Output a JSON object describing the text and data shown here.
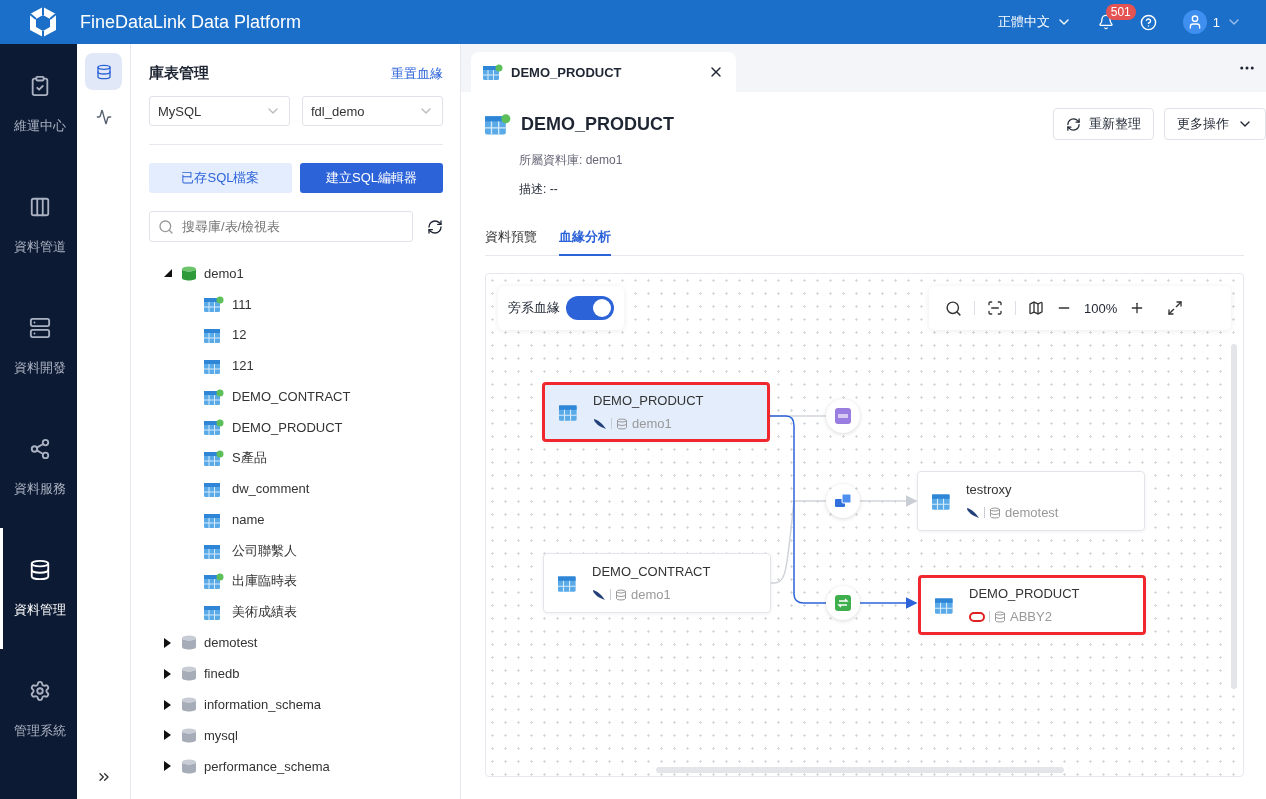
{
  "header": {
    "title": "FineDataLink Data Platform",
    "language": "正體中文",
    "notifications": "501",
    "user": "1"
  },
  "nav": [
    {
      "label": "維運中心",
      "selected": false
    },
    {
      "label": "資料管道",
      "selected": false
    },
    {
      "label": "資料開發",
      "selected": false
    },
    {
      "label": "資料服務",
      "selected": false
    },
    {
      "label": "資料管理",
      "selected": true
    },
    {
      "label": "管理系統",
      "selected": false
    }
  ],
  "subnav": [
    {
      "selected": true
    },
    {
      "selected": false
    }
  ],
  "panel": {
    "title": "庫表管理",
    "reset_link": "重置血緣",
    "db_type": "MySQL",
    "db_name": "fdl_demo",
    "saved_button": "已存SQL檔案",
    "create_button": "建立SQL編輯器",
    "search": {
      "placeholder": "搜尋庫/表/檢視表"
    },
    "tree": [
      {
        "label": "demo1",
        "expanded": true,
        "selected": true,
        "children": [
          {
            "label": "111",
            "kind": "tagged"
          },
          {
            "label": "12",
            "kind": "plain"
          },
          {
            "label": "121",
            "kind": "plain"
          },
          {
            "label": "DEMO_CONTRACT",
            "kind": "tagged"
          },
          {
            "label": "DEMO_PRODUCT",
            "kind": "tagged"
          },
          {
            "label": "S產品",
            "kind": "tagged"
          },
          {
            "label": "dw_comment",
            "kind": "plain"
          },
          {
            "label": "name",
            "kind": "plain"
          },
          {
            "label": "公司聯繫人",
            "kind": "plain"
          },
          {
            "label": "出庫臨時表",
            "kind": "tagged"
          },
          {
            "label": "美術成績表",
            "kind": "plain"
          }
        ]
      },
      {
        "label": "demotest",
        "expanded": false,
        "selected": false
      },
      {
        "label": "finedb",
        "expanded": false,
        "selected": false
      },
      {
        "label": "information_schema",
        "expanded": false,
        "selected": false
      },
      {
        "label": "mysql",
        "expanded": false,
        "selected": false
      },
      {
        "label": "performance_schema",
        "expanded": false,
        "selected": false
      }
    ]
  },
  "tab": {
    "label": "DEMO_PRODUCT"
  },
  "detail": {
    "title": "DEMO_PRODUCT",
    "database_line": "所屬資料庫: demo1",
    "description_line": "描述: --",
    "refresh_button": "重新整理",
    "more_button": "更多操作",
    "tabs": [
      {
        "label": "資料預覽",
        "selected": false
      },
      {
        "label": "血緣分析",
        "selected": true
      }
    ]
  },
  "lineage": {
    "side_lineage_label": "旁系血緣",
    "side_lineage_on": true,
    "zoom": "100%",
    "nodes": [
      {
        "name": "DEMO_PRODUCT",
        "kind": "mysql",
        "db": "demo1",
        "highlighted": true,
        "selected": true
      },
      {
        "name": "testroxy",
        "kind": "mysql",
        "db": "demotest",
        "highlighted": false,
        "selected": false
      },
      {
        "name": "DEMO_CONTRACT",
        "kind": "mysql",
        "db": "demo1",
        "highlighted": false,
        "selected": false
      },
      {
        "name": "DEMO_PRODUCT",
        "kind": "oracle",
        "db": "ABBY2",
        "highlighted": true,
        "selected": false
      }
    ],
    "links": [
      {
        "kind": "api"
      },
      {
        "kind": "pipeline"
      },
      {
        "kind": "transform"
      }
    ]
  }
}
